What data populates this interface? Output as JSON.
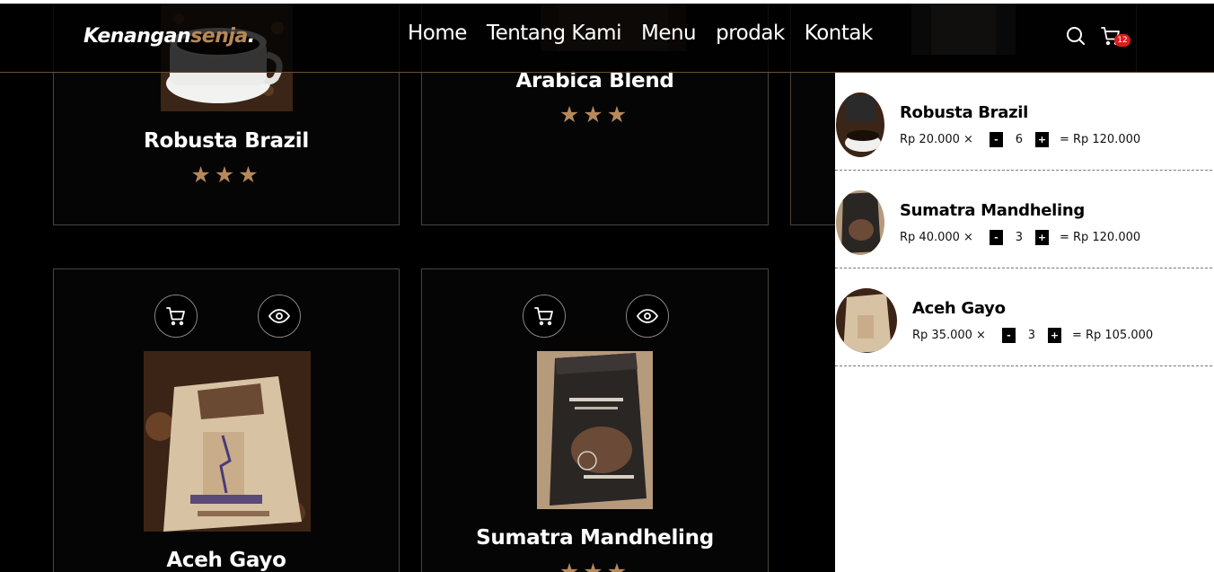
{
  "header": {
    "logo_part1": "Kenangan",
    "logo_part2": "senja",
    "logo_part3": ".",
    "nav": [
      "Home",
      "Tentang Kami",
      "Menu",
      "prodak",
      "Kontak"
    ],
    "cart_count": "12"
  },
  "products": [
    {
      "name": "Robusta Brazil",
      "stars": "★★★"
    },
    {
      "name": "Arabica Blend",
      "stars": "★★★"
    },
    {
      "name": "Aceh Gayo",
      "stars": "★★★"
    },
    {
      "name": "Sumatra Mandheling",
      "stars": "★★★"
    }
  ],
  "cart": {
    "items": [
      {
        "name": "Robusta Brazil",
        "price": "Rp 20.000 ×",
        "minus": "-",
        "qty": "6",
        "plus": "+",
        "total": "= Rp 120.000"
      },
      {
        "name": "Sumatra Mandheling",
        "price": "Rp 40.000 ×",
        "minus": "-",
        "qty": "3",
        "plus": "+",
        "total": "= Rp 120.000"
      },
      {
        "name": "Aceh Gayo",
        "price": "Rp 35.000 ×",
        "minus": "-",
        "qty": "3",
        "plus": "+",
        "total": "= Rp 105.000"
      }
    ]
  },
  "colors": {
    "accent": "#b6895b",
    "badge": "#e01b1b",
    "background": "#000000"
  },
  "icons": [
    "search-icon",
    "shopping-cart-icon",
    "eye-icon"
  ]
}
